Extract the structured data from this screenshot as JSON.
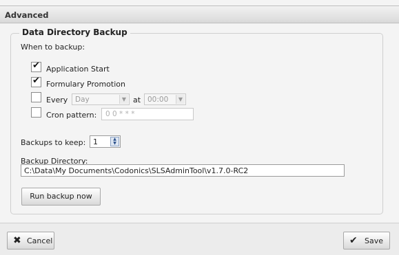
{
  "header": {
    "title": "Advanced"
  },
  "backup": {
    "legend": "Data Directory Backup",
    "when_label": "When to backup:",
    "options": {
      "application_start": {
        "label": "Application Start",
        "checked": true
      },
      "formulary_promotion": {
        "label": "Formulary Promotion",
        "checked": true
      },
      "every": {
        "label": "Every",
        "checked": false,
        "period_value": "Day",
        "at_label": "at",
        "time_value": "00:00"
      },
      "cron": {
        "label": "Cron pattern:",
        "checked": false,
        "pattern_value": "0 0 * * *"
      }
    },
    "keep_label": "Backups to keep:",
    "keep_value": "1",
    "directory_label": "Backup Directory:",
    "directory_value": "C:\\Data\\My Documents\\Codonics\\SLSAdminTool\\v1.7.0-RC2",
    "run_button": "Run backup now"
  },
  "footer": {
    "cancel_label": "Cancel",
    "save_label": "Save"
  },
  "icons": {
    "cancel": "close-icon",
    "save": "checkmark-icon"
  }
}
